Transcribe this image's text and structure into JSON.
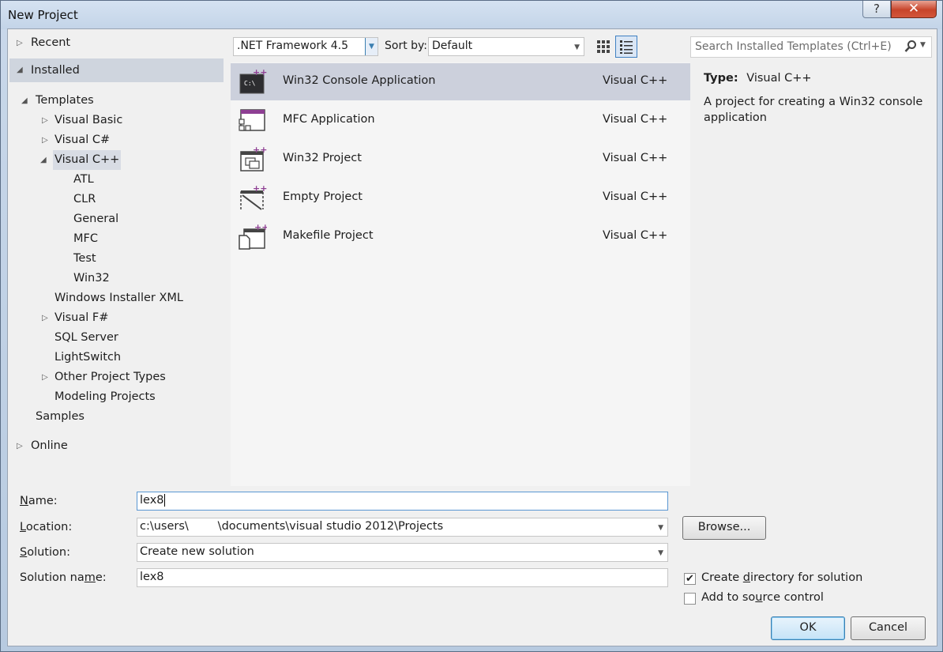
{
  "window": {
    "title": "New Project",
    "help_glyph": "?",
    "close_glyph": "✕"
  },
  "tree": {
    "recent": "Recent",
    "installed": "Installed",
    "templates": "Templates",
    "visual_basic": "Visual Basic",
    "visual_csharp": "Visual C#",
    "visual_cpp": "Visual C++",
    "cpp_children": [
      "ATL",
      "CLR",
      "General",
      "MFC",
      "Test",
      "Win32"
    ],
    "windows_installer_xml": "Windows Installer XML",
    "visual_fsharp": "Visual F#",
    "sql_server": "SQL Server",
    "lightswitch": "LightSwitch",
    "other_project_types": "Other Project Types",
    "modeling_projects": "Modeling Projects",
    "samples": "Samples",
    "online": "Online"
  },
  "toolbar": {
    "framework": ".NET Framework 4.5",
    "sort_label": "Sort by:",
    "sort_value": "Default",
    "search_placeholder": "Search Installed Templates (Ctrl+E)"
  },
  "templates": [
    {
      "name": "Win32 Console Application",
      "lang": "Visual C++",
      "icon": "console-app-icon",
      "selected": true
    },
    {
      "name": "MFC Application",
      "lang": "Visual C++",
      "icon": "mfc-app-icon",
      "selected": false
    },
    {
      "name": "Win32 Project",
      "lang": "Visual C++",
      "icon": "win32-project-icon",
      "selected": false
    },
    {
      "name": "Empty Project",
      "lang": "Visual C++",
      "icon": "empty-project-icon",
      "selected": false
    },
    {
      "name": "Makefile Project",
      "lang": "Visual C++",
      "icon": "makefile-project-icon",
      "selected": false
    }
  ],
  "details": {
    "type_label": "Type:",
    "type_value": "Visual C++",
    "description": "A project for creating a Win32 console application"
  },
  "form": {
    "name_label": "Name:",
    "name_value": "lex8",
    "location_label": "Location:",
    "location_value": "c:\\users\\        \\documents\\visual studio 2012\\Projects",
    "solution_label": "Solution:",
    "solution_value": "Create new solution",
    "solution_name_label": "Solution name:",
    "solution_name_value": "lex8",
    "browse": "Browse...",
    "create_dir": "Create directory for solution",
    "create_dir_checked": true,
    "source_control": "Add to source control",
    "source_control_checked": false,
    "ok": "OK",
    "cancel": "Cancel"
  },
  "colors": {
    "accent": "#3c7fb1",
    "selection": "#ccd0dc",
    "icon_purple": "#8e3f93"
  }
}
